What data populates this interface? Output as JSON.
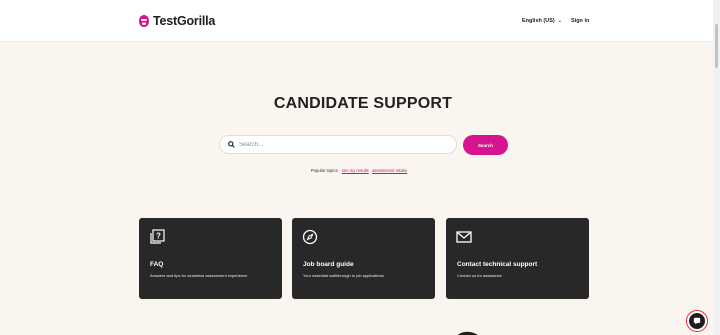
{
  "header": {
    "brand": "TestGorilla",
    "language": "English (US)",
    "sign_in": "Sign in",
    "brand_color": "#d7138f",
    "logo_icon": "gorilla-logo-icon",
    "chevron_icon": "chevron-down-icon"
  },
  "main": {
    "title": "CANDIDATE SUPPORT",
    "search": {
      "placeholder": "Search...",
      "value": "",
      "button_label": "Search",
      "icon": "search-icon"
    },
    "popular": {
      "label": "Popular topics:",
      "links": [
        "see my results",
        "assessment retake"
      ]
    }
  },
  "cards": [
    {
      "title": "FAQ",
      "description": "Answers and tips for seamless assessment experience",
      "icon": "faq-icon"
    },
    {
      "title": "Job board guide",
      "description": "Your essential walkthrough to job applications",
      "icon": "compass-icon"
    },
    {
      "title": "Contact technical support",
      "description": "Contact us for assistance",
      "icon": "mail-icon"
    }
  ],
  "chat": {
    "icon": "chat-icon"
  },
  "colors": {
    "accent": "#d7138f",
    "background": "#fbf5ef",
    "card": "#282828"
  }
}
